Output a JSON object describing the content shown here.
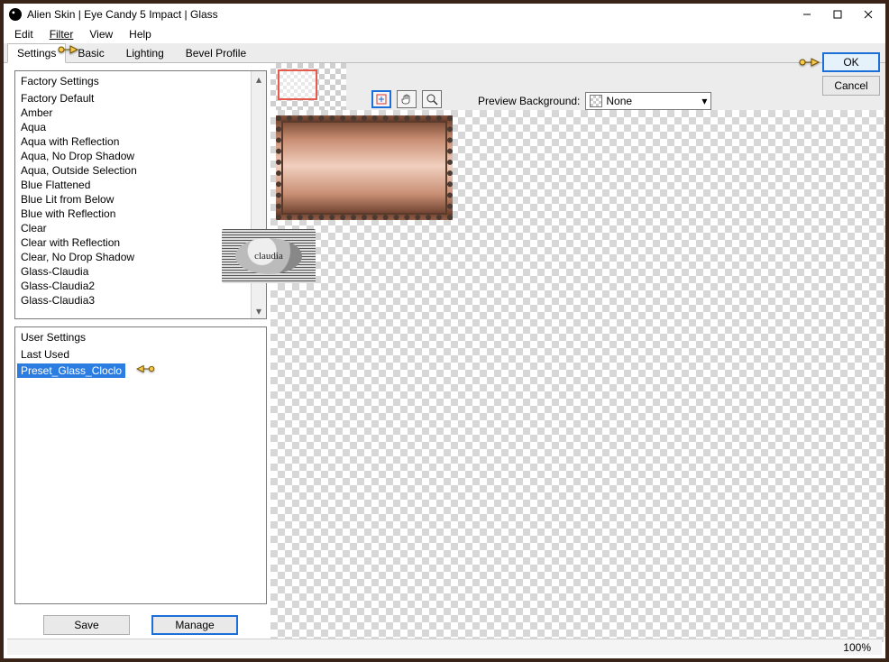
{
  "window": {
    "title": "Alien Skin | Eye Candy 5 Impact | Glass"
  },
  "menu": {
    "edit": "Edit",
    "filter": "Filter",
    "view": "View",
    "help": "Help"
  },
  "tabs": {
    "settings": "Settings",
    "basic": "Basic",
    "lighting": "Lighting",
    "bevel": "Bevel Profile"
  },
  "buttons": {
    "ok": "OK",
    "cancel": "Cancel",
    "save": "Save",
    "manage": "Manage"
  },
  "factory": {
    "header": "Factory Settings",
    "items": [
      "Factory Default",
      "Amber",
      "Aqua",
      "Aqua with Reflection",
      "Aqua, No Drop Shadow",
      "Aqua, Outside Selection",
      "Blue Flattened",
      "Blue Lit from Below",
      "Blue with Reflection",
      "Clear",
      "Clear with Reflection",
      "Clear, No Drop Shadow",
      "Glass-Claudia",
      "Glass-Claudia2",
      "Glass-Claudia3"
    ]
  },
  "user": {
    "header": "User Settings",
    "items": [
      "Last Used",
      "Preset_Glass_Cloclo"
    ],
    "selected_index": 1
  },
  "preview": {
    "label": "Preview Background:",
    "value": "None"
  },
  "watermark": {
    "text": "claudia"
  },
  "status": {
    "zoom": "100%"
  },
  "icons": {
    "minimize": "minimize-icon",
    "maximize": "maximize-icon",
    "close": "close-icon",
    "nav": "nav-icon",
    "hand": "hand-icon",
    "zoom": "zoom-icon"
  }
}
